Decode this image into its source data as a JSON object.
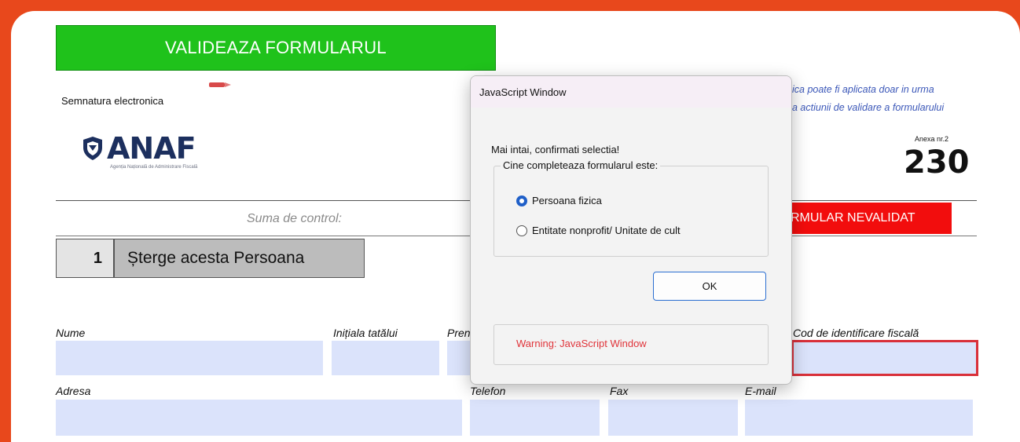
{
  "form": {
    "validate_button": "VALIDEAZA FORMULARUL",
    "signature_label": "Semnatura electronica",
    "logo_text": "ANAF",
    "logo_subtitle": "Agenția Națională de Administrare Fiscală",
    "signature_note_line1": "ica poate fi aplicata doar in urma",
    "signature_note_line2": "a actiunii de validare a formularului",
    "annex_label": "Anexa nr.2",
    "form_number": "230",
    "control_sum_label": "Suma de control:",
    "status_badge": "RMULAR NEVALIDAT",
    "person_number": "1",
    "delete_person_button": "Șterge acesta Persoana",
    "labels": {
      "name": "Nume",
      "father_initial": "Inițiala tatălui",
      "first_name_partial": "Pren",
      "fiscal_code": "Cod de identificare fiscală",
      "address": "Adresa",
      "phone": "Telefon",
      "fax": "Fax",
      "email": "E-mail"
    }
  },
  "dialog": {
    "title": "JavaScript Window",
    "message": "Mai intai, confirmati selectia!",
    "group_label": "Cine completeaza formularul este:",
    "options": [
      {
        "label": "Persoana fizica",
        "selected": true
      },
      {
        "label": "Entitate nonprofit/ Unitate de cult",
        "selected": false
      }
    ],
    "ok_button": "OK",
    "warning": "Warning: JavaScript Window"
  },
  "colors": {
    "background": "#e8481c",
    "validate_green": "#1fc21b",
    "invalid_red": "#f20d0d",
    "field_blue": "#dbe3fb",
    "note_blue": "#3b57b8"
  }
}
